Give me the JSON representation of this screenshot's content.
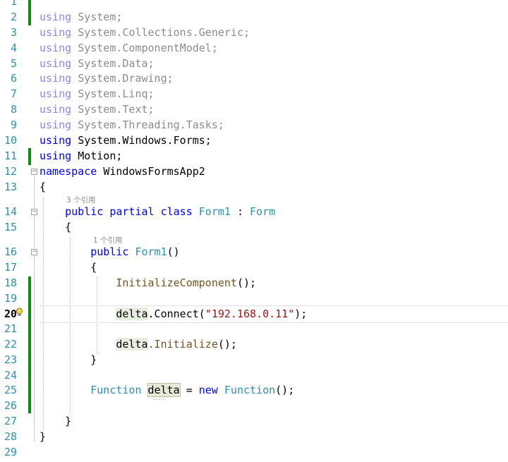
{
  "editor": {
    "line_numbers": [
      "1",
      "2",
      "3",
      "4",
      "5",
      "6",
      "7",
      "8",
      "9",
      "10",
      "11",
      "12",
      "13",
      "14",
      "15",
      "16",
      "17",
      "18",
      "19",
      "20",
      "21",
      "22",
      "23",
      "24",
      "25",
      "26",
      "27",
      "28",
      "29"
    ],
    "current_line": "20",
    "codelens": {
      "class_refs": "3 个引用",
      "ctor_refs": "1 个引用"
    },
    "code": {
      "using_kw": "using",
      "u_system": "System;",
      "u_generic": "System.Collections.Generic;",
      "u_component": "System.ComponentModel;",
      "u_data": "System.Data;",
      "u_drawing": "System.Drawing;",
      "u_linq": "System.Linq;",
      "u_text": "System.Text;",
      "u_tasks": "System.Threading.Tasks;",
      "u_forms": "System.Windows.Forms;",
      "u_motion": "Motion;",
      "namespace_kw": "namespace",
      "namespace_name": "WindowsFormsApp2",
      "open_brace": "{",
      "close_brace": "}",
      "public_kw": "public",
      "partial_kw": "partial",
      "class_kw": "class",
      "class_name": "Form1",
      "colon": ":",
      "base_class": "Form",
      "ctor_name": "Form1",
      "parens": "()",
      "init_call": "InitializeComponent",
      "call_end": "();",
      "delta_var": "delta",
      "connect_method": ".Connect(",
      "ip_string": "\"192.168.0.11\"",
      "connect_end": ");",
      "initialize_method": ".Initialize",
      "function_type": "Function",
      "assign": "=",
      "new_kw": "new",
      "new_type": "Function",
      "dots": "....."
    },
    "colors": {
      "keyword": "#0000ff",
      "type": "#2b91af",
      "string": "#a31515",
      "method": "#74531f",
      "change_bar": "#128a12",
      "line_number": "#2b91af"
    }
  }
}
